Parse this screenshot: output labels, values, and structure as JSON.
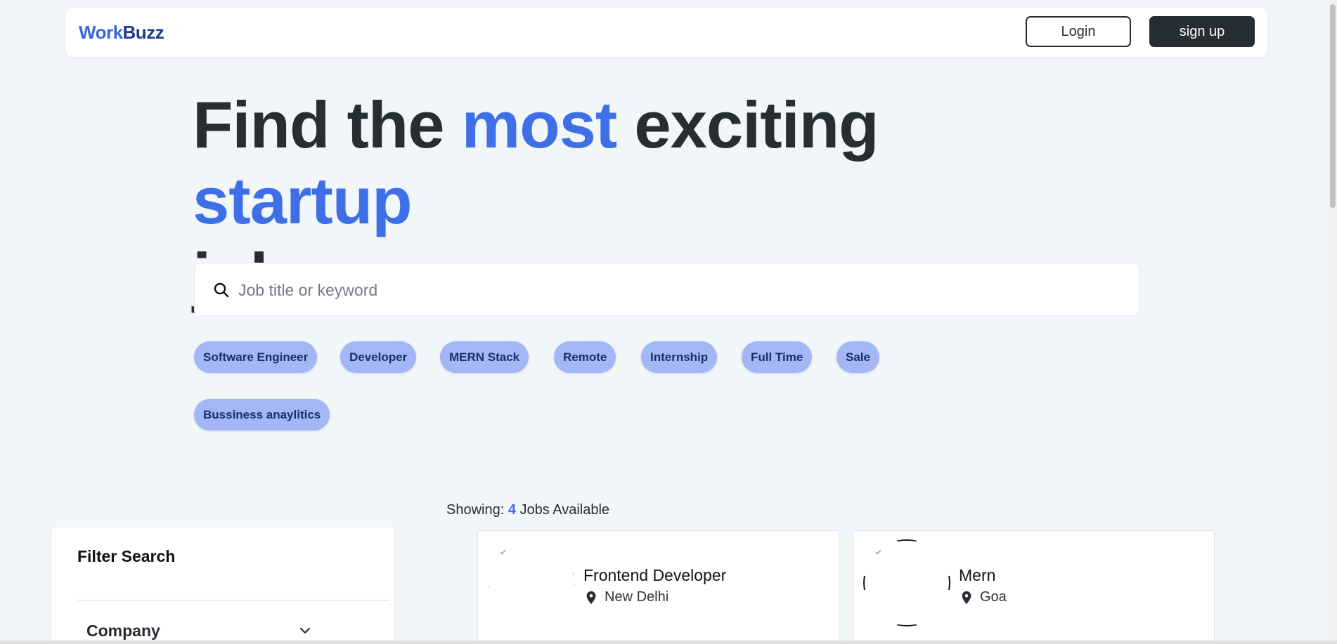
{
  "navbar": {
    "logo_part1": "Work",
    "logo_part2": "Buzz",
    "login_label": "Login",
    "signup_label": "sign up"
  },
  "hero": {
    "w1": "Find the ",
    "w2": "most",
    "w3": " exciting ",
    "w4": "startup",
    "w5": "jobs"
  },
  "search": {
    "placeholder": "Job title or keyword",
    "value": ""
  },
  "tags": [
    "Software Engineer",
    "Developer",
    "MERN Stack",
    "Remote",
    "Internship",
    "Full Time",
    "Sale",
    "Bussiness anaylitics"
  ],
  "results": {
    "prefix": "Showing:",
    "count": "4",
    "suffix": "Jobs Available"
  },
  "filter": {
    "title": "Filter Search",
    "company_label": "Company"
  },
  "jobs": [
    {
      "title": "Frontend Developer",
      "location": "New Delhi"
    },
    {
      "title": "Mern",
      "location": "Goa"
    }
  ],
  "colors": {
    "accent": "#3f6fe6",
    "dark": "#262d33",
    "tag_bg": "#a3b6f6",
    "background": "#f1f6f9"
  }
}
